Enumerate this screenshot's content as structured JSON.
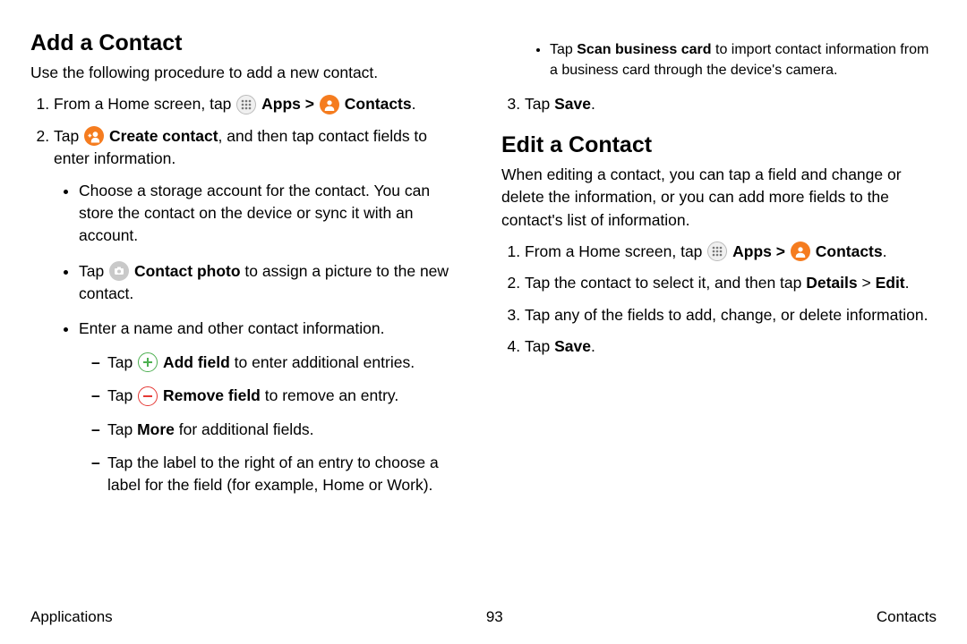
{
  "sectionA": {
    "heading": "Add a Contact",
    "intro": "Use the following procedure to add a new contact.",
    "step1_a": "From a Home screen, tap ",
    "apps": "Apps",
    "arrow": " > ",
    "contacts": "Contacts",
    "period": ".",
    "step2_a": "Tap ",
    "step2_b": "Create contact",
    "step2_c": ", and then tap contact fields to enter information.",
    "b1": "Choose a storage account for the contact. You can store the contact on the device or sync it with an account.",
    "b2_a": "Tap ",
    "b2_b": "Contact photo",
    "b2_c": " to assign a picture to the new contact.",
    "b3": "Enter a name and other contact information.",
    "d1_a": "Tap ",
    "d1_b": "Add field",
    "d1_c": " to enter additional entries.",
    "d2_a": "Tap ",
    "d2_b": "Remove field",
    "d2_c": " to remove an entry.",
    "d3_a": "Tap ",
    "d3_b": "More",
    "d3_c": " for additional fields.",
    "d4": "Tap the label to the right of an entry to choose a label for the field (for example, Home or Work).",
    "b4_a": "Tap ",
    "b4_b": "Scan business card",
    "b4_c": " to import contact information from a business card through the device's camera.",
    "step3_a": "Tap ",
    "step3_b": "Save",
    "step3_c": "."
  },
  "sectionB": {
    "heading": "Edit a Contact",
    "intro": "When editing a contact, you can tap a field and change or delete the information, or you can add more fields to the contact's list of information.",
    "s1_a": "From a Home screen, tap ",
    "s2_a": "Tap the contact to select it, and then tap ",
    "s2_b": "Details",
    "s2_c": " > ",
    "s2_d": "Edit",
    "s2_e": ".",
    "s3": "Tap any of the fields to add, change, or delete information.",
    "s4_a": "Tap ",
    "s4_b": "Save",
    "s4_c": "."
  },
  "footer": {
    "left": "Applications",
    "center": "93",
    "right": "Contacts"
  }
}
